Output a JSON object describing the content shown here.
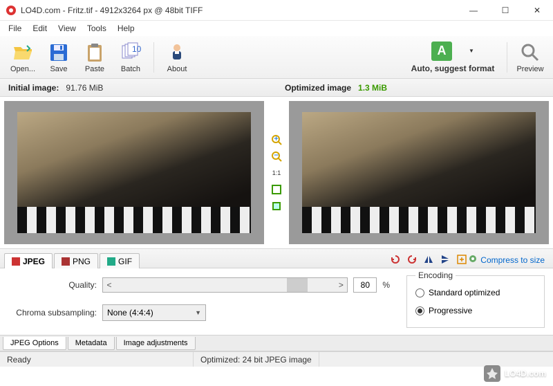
{
  "window": {
    "title": "LO4D.com - Fritz.tif - 4912x3264 px @ 48bit TIFF",
    "controls": {
      "min": "—",
      "max": "☐",
      "close": "✕"
    }
  },
  "menubar": [
    "File",
    "Edit",
    "View",
    "Tools",
    "Help"
  ],
  "toolbar": {
    "open": "Open...",
    "save": "Save",
    "paste": "Paste",
    "batch": "Batch",
    "about": "About",
    "auto": "Auto, suggest format",
    "preview": "Preview"
  },
  "info": {
    "initial_label": "Initial image:",
    "initial_value": "91.76 MiB",
    "optimized_label": "Optimized image",
    "optimized_value": "1.3 MiB"
  },
  "center_tools": {
    "zoom_in": "+",
    "zoom_out": "−",
    "one_to_one": "1:1",
    "fit": "▢",
    "full": "▦"
  },
  "format_tabs": {
    "jpeg": "JPEG",
    "png": "PNG",
    "gif": "GIF",
    "compress": "Compress to size"
  },
  "jpeg_options": {
    "quality_label": "Quality:",
    "quality_value": "80",
    "quality_pct": "%",
    "chroma_label": "Chroma subsampling:",
    "chroma_value": "None (4:4:4)",
    "encoding_legend": "Encoding",
    "encoding_standard": "Standard optimized",
    "encoding_progressive": "Progressive"
  },
  "bottom_tabs": {
    "jpeg_options": "JPEG Options",
    "metadata": "Metadata",
    "image_adjustments": "Image adjustments"
  },
  "statusbar": {
    "ready": "Ready",
    "optimized": "Optimized: 24 bit JPEG image"
  },
  "watermark": {
    "brand": "LO4D",
    "suffix": ".com"
  }
}
